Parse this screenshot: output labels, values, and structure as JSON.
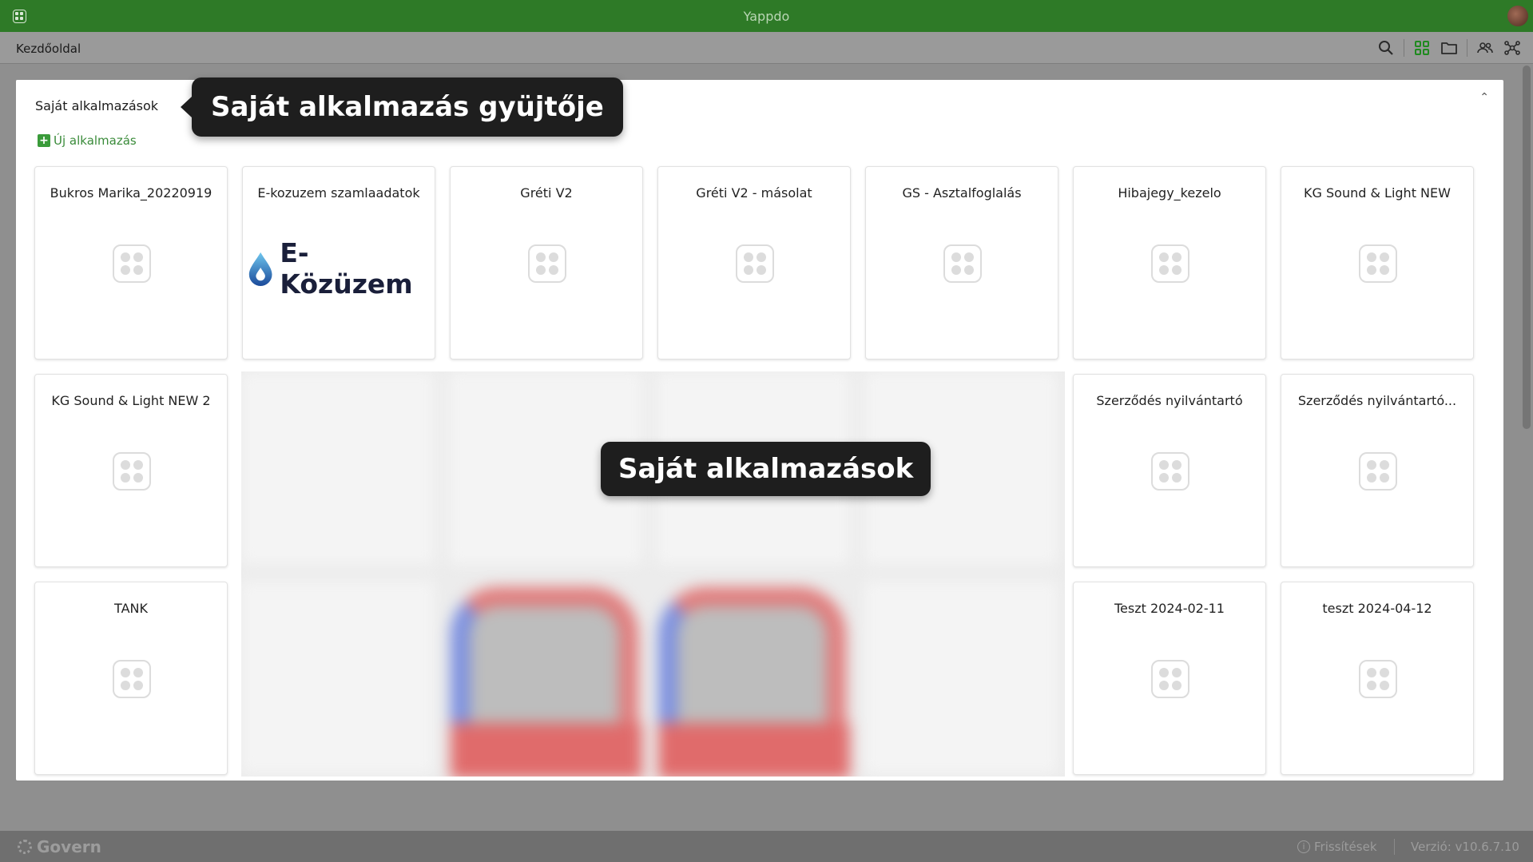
{
  "titlebar": {
    "title": "Yappdo"
  },
  "toolbar": {
    "breadcrumb": "Kezdőoldal"
  },
  "panel": {
    "tab_label": "Saját alkalmazások",
    "new_app_label": "Új alkalmazás",
    "collapse_glyph": "⌃"
  },
  "apps": [
    {
      "name": "Bukros Marika_20220919"
    },
    {
      "name": "E-kozuzem szamlaadatok",
      "logo_text": "E-Közüzem"
    },
    {
      "name": "Gréti V2"
    },
    {
      "name": "Gréti V2 - másolat"
    },
    {
      "name": "GS - Asztalfoglalás"
    },
    {
      "name": "Hibajegy_kezelo"
    },
    {
      "name": "KG Sound & Light NEW"
    },
    {
      "name": "KG Sound & Light NEW 2"
    },
    {
      "name": "Szerződés nyilvántartó"
    },
    {
      "name": "Szerződés nyilvántartó..."
    },
    {
      "name": "TANK"
    },
    {
      "name": "Teszt 2024-02-11"
    },
    {
      "name": "teszt 2024-04-12"
    }
  ],
  "tooltips": {
    "collector": "Saját alkalmazás gyüjtője",
    "my_apps": "Saját alkalmazások"
  },
  "statusbar": {
    "brand": "Govern",
    "updates": "Frissítések",
    "version": "Verzió: v10.6.7.10"
  },
  "colors": {
    "titlebar": "#2e7a27",
    "accent_green": "#3a9b3a",
    "tooltip_bg": "#1e1e1e"
  },
  "icons": [
    "menu-icon",
    "search-icon",
    "grid-view-icon",
    "folder-icon",
    "users-icon",
    "network-icon",
    "app-placeholder-icon",
    "water-drop-icon",
    "gear-logo-icon",
    "info-icon"
  ]
}
